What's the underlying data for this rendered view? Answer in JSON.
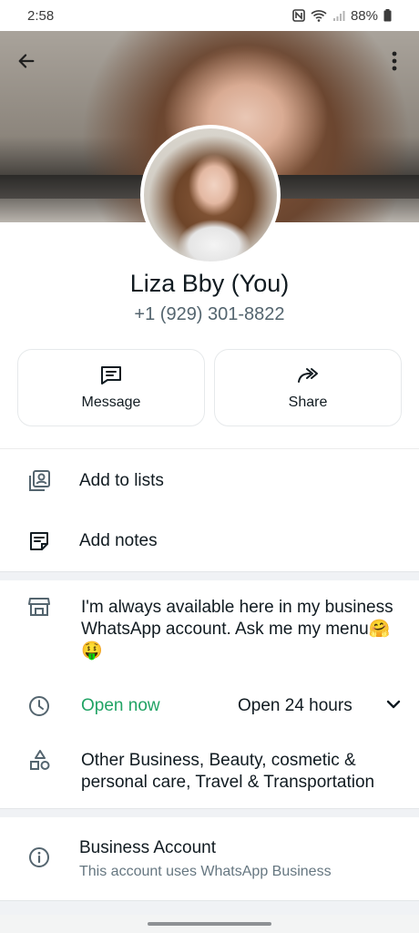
{
  "status": {
    "time": "2:58",
    "battery": "88%"
  },
  "profile": {
    "name": "Liza Bby (You)",
    "phone": "+1 (929) 301-8822"
  },
  "actions": [
    {
      "label": "Message",
      "icon": "message-icon"
    },
    {
      "label": "Share",
      "icon": "share-icon"
    }
  ],
  "menu": {
    "add_to_lists": "Add to lists",
    "add_notes": "Add notes"
  },
  "business": {
    "about": "I'm always available here in my business WhatsApp account. Ask me my menu🤗🤑",
    "open_status": "Open now",
    "hours": "Open 24 hours",
    "categories": "Other Business, Beauty, cosmetic & personal care, Travel & Transportation",
    "account_title": "Business Account",
    "account_subtitle": "This account uses WhatsApp Business"
  },
  "colors": {
    "open_green": "#21a365",
    "text_primary": "#111b21",
    "text_secondary": "#667781"
  }
}
